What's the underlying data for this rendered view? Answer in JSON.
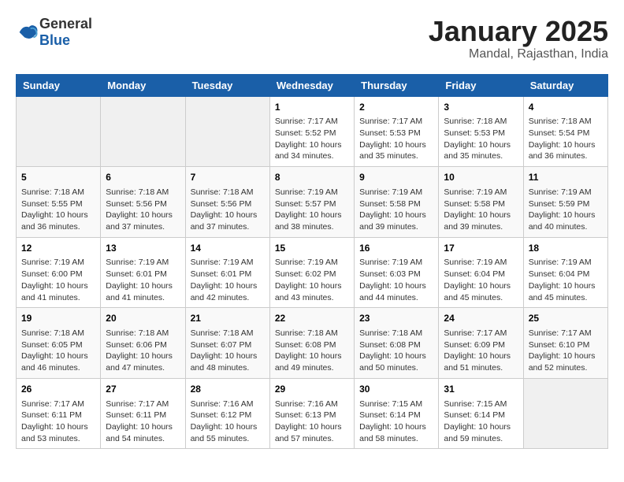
{
  "logo": {
    "text_general": "General",
    "text_blue": "Blue"
  },
  "header": {
    "month_title": "January 2025",
    "location": "Mandal, Rajasthan, India"
  },
  "weekdays": [
    "Sunday",
    "Monday",
    "Tuesday",
    "Wednesday",
    "Thursday",
    "Friday",
    "Saturday"
  ],
  "weeks": [
    [
      {
        "day": "",
        "info": ""
      },
      {
        "day": "",
        "info": ""
      },
      {
        "day": "",
        "info": ""
      },
      {
        "day": "1",
        "info": "Sunrise: 7:17 AM\nSunset: 5:52 PM\nDaylight: 10 hours\nand 34 minutes."
      },
      {
        "day": "2",
        "info": "Sunrise: 7:17 AM\nSunset: 5:53 PM\nDaylight: 10 hours\nand 35 minutes."
      },
      {
        "day": "3",
        "info": "Sunrise: 7:18 AM\nSunset: 5:53 PM\nDaylight: 10 hours\nand 35 minutes."
      },
      {
        "day": "4",
        "info": "Sunrise: 7:18 AM\nSunset: 5:54 PM\nDaylight: 10 hours\nand 36 minutes."
      }
    ],
    [
      {
        "day": "5",
        "info": "Sunrise: 7:18 AM\nSunset: 5:55 PM\nDaylight: 10 hours\nand 36 minutes."
      },
      {
        "day": "6",
        "info": "Sunrise: 7:18 AM\nSunset: 5:56 PM\nDaylight: 10 hours\nand 37 minutes."
      },
      {
        "day": "7",
        "info": "Sunrise: 7:18 AM\nSunset: 5:56 PM\nDaylight: 10 hours\nand 37 minutes."
      },
      {
        "day": "8",
        "info": "Sunrise: 7:19 AM\nSunset: 5:57 PM\nDaylight: 10 hours\nand 38 minutes."
      },
      {
        "day": "9",
        "info": "Sunrise: 7:19 AM\nSunset: 5:58 PM\nDaylight: 10 hours\nand 39 minutes."
      },
      {
        "day": "10",
        "info": "Sunrise: 7:19 AM\nSunset: 5:58 PM\nDaylight: 10 hours\nand 39 minutes."
      },
      {
        "day": "11",
        "info": "Sunrise: 7:19 AM\nSunset: 5:59 PM\nDaylight: 10 hours\nand 40 minutes."
      }
    ],
    [
      {
        "day": "12",
        "info": "Sunrise: 7:19 AM\nSunset: 6:00 PM\nDaylight: 10 hours\nand 41 minutes."
      },
      {
        "day": "13",
        "info": "Sunrise: 7:19 AM\nSunset: 6:01 PM\nDaylight: 10 hours\nand 41 minutes."
      },
      {
        "day": "14",
        "info": "Sunrise: 7:19 AM\nSunset: 6:01 PM\nDaylight: 10 hours\nand 42 minutes."
      },
      {
        "day": "15",
        "info": "Sunrise: 7:19 AM\nSunset: 6:02 PM\nDaylight: 10 hours\nand 43 minutes."
      },
      {
        "day": "16",
        "info": "Sunrise: 7:19 AM\nSunset: 6:03 PM\nDaylight: 10 hours\nand 44 minutes."
      },
      {
        "day": "17",
        "info": "Sunrise: 7:19 AM\nSunset: 6:04 PM\nDaylight: 10 hours\nand 45 minutes."
      },
      {
        "day": "18",
        "info": "Sunrise: 7:19 AM\nSunset: 6:04 PM\nDaylight: 10 hours\nand 45 minutes."
      }
    ],
    [
      {
        "day": "19",
        "info": "Sunrise: 7:18 AM\nSunset: 6:05 PM\nDaylight: 10 hours\nand 46 minutes."
      },
      {
        "day": "20",
        "info": "Sunrise: 7:18 AM\nSunset: 6:06 PM\nDaylight: 10 hours\nand 47 minutes."
      },
      {
        "day": "21",
        "info": "Sunrise: 7:18 AM\nSunset: 6:07 PM\nDaylight: 10 hours\nand 48 minutes."
      },
      {
        "day": "22",
        "info": "Sunrise: 7:18 AM\nSunset: 6:08 PM\nDaylight: 10 hours\nand 49 minutes."
      },
      {
        "day": "23",
        "info": "Sunrise: 7:18 AM\nSunset: 6:08 PM\nDaylight: 10 hours\nand 50 minutes."
      },
      {
        "day": "24",
        "info": "Sunrise: 7:17 AM\nSunset: 6:09 PM\nDaylight: 10 hours\nand 51 minutes."
      },
      {
        "day": "25",
        "info": "Sunrise: 7:17 AM\nSunset: 6:10 PM\nDaylight: 10 hours\nand 52 minutes."
      }
    ],
    [
      {
        "day": "26",
        "info": "Sunrise: 7:17 AM\nSunset: 6:11 PM\nDaylight: 10 hours\nand 53 minutes."
      },
      {
        "day": "27",
        "info": "Sunrise: 7:17 AM\nSunset: 6:11 PM\nDaylight: 10 hours\nand 54 minutes."
      },
      {
        "day": "28",
        "info": "Sunrise: 7:16 AM\nSunset: 6:12 PM\nDaylight: 10 hours\nand 55 minutes."
      },
      {
        "day": "29",
        "info": "Sunrise: 7:16 AM\nSunset: 6:13 PM\nDaylight: 10 hours\nand 57 minutes."
      },
      {
        "day": "30",
        "info": "Sunrise: 7:15 AM\nSunset: 6:14 PM\nDaylight: 10 hours\nand 58 minutes."
      },
      {
        "day": "31",
        "info": "Sunrise: 7:15 AM\nSunset: 6:14 PM\nDaylight: 10 hours\nand 59 minutes."
      },
      {
        "day": "",
        "info": ""
      }
    ]
  ]
}
